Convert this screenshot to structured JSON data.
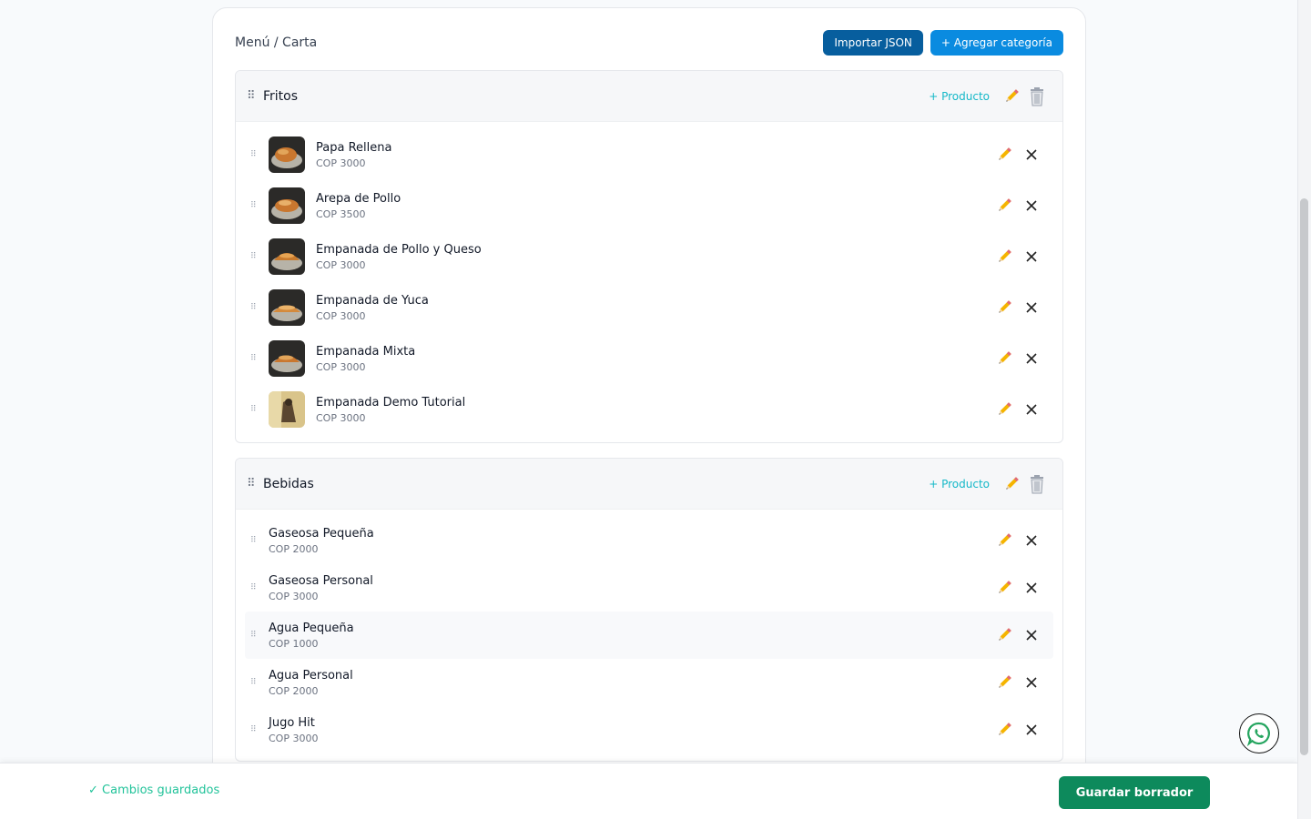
{
  "breadcrumb": "Menú / Carta",
  "header_actions": {
    "import_json": "Importar JSON",
    "add_category": "+ Agregar categoría"
  },
  "categories": [
    {
      "name": "Fritos",
      "add_product": "+ Producto",
      "items": [
        {
          "name": "Papa Rellena",
          "price": "COP 3000"
        },
        {
          "name": "Arepa de Pollo",
          "price": "COP 3500"
        },
        {
          "name": "Empanada de Pollo y Queso",
          "price": "COP 3000"
        },
        {
          "name": "Empanada de Yuca",
          "price": "COP 3000"
        },
        {
          "name": "Empanada Mixta",
          "price": "COP 3000"
        },
        {
          "name": "Empanada Demo Tutorial",
          "price": "COP 3000"
        }
      ]
    },
    {
      "name": "Bebidas",
      "add_product": "+ Producto",
      "items": [
        {
          "name": "Gaseosa Pequeña",
          "price": "COP 2000"
        },
        {
          "name": "Gaseosa Personal",
          "price": "COP 3000"
        },
        {
          "name": "Agua Pequeña",
          "price": "COP 1000"
        },
        {
          "name": "Agua Personal",
          "price": "COP 2000"
        },
        {
          "name": "Jugo Hit",
          "price": "COP 3000"
        }
      ]
    }
  ],
  "footer": {
    "status": "✓ Cambios guardados",
    "save_draft": "Guardar borrador"
  },
  "icons": {
    "drag": "drag-handle-icon",
    "edit": "pencil-icon",
    "delete_category": "trash-icon",
    "remove_item": "close-icon",
    "chat": "whatsapp-icon"
  },
  "colors": {
    "primary_dark": "#075e9e",
    "primary": "#0a8be0",
    "accent_teal": "#14b8c8",
    "success": "#22c39a",
    "save_button": "#0d8a5c"
  }
}
